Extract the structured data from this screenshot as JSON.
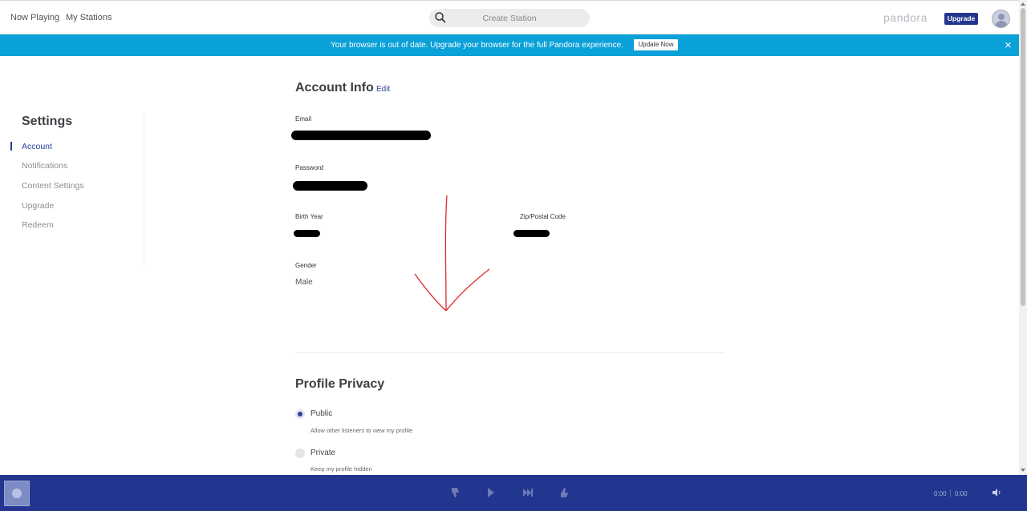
{
  "nav": {
    "now_playing": "Now Playing",
    "my_stations": "My Stations",
    "search_placeholder": "Create Station",
    "brand": "pandora",
    "upgrade": "Upgrade"
  },
  "banner": {
    "message": "Your browser is out of date. Upgrade your browser for the full Pandora experience.",
    "button": "Update Now",
    "close": "×"
  },
  "sidebar": {
    "title": "Settings",
    "items": [
      {
        "label": "Account",
        "active": true
      },
      {
        "label": "Notifications",
        "active": false
      },
      {
        "label": "Content Settings",
        "active": false
      },
      {
        "label": "Upgrade",
        "active": false
      },
      {
        "label": "Redeem",
        "active": false
      }
    ]
  },
  "account": {
    "title": "Account Info",
    "edit": "Edit",
    "email_label": "Email",
    "password_label": "Password",
    "birth_year_label": "Birth Year",
    "zip_label": "Zip/Postal Code",
    "gender_label": "Gender",
    "gender_value": "Male"
  },
  "privacy": {
    "title": "Profile Privacy",
    "options": [
      {
        "label": "Public",
        "desc": "Allow other listeners to view my profile",
        "selected": true
      },
      {
        "label": "Private",
        "desc": "Keep my profile hidden",
        "selected": false
      }
    ]
  },
  "player": {
    "elapsed": "0:00",
    "duration": "0:00"
  },
  "colors": {
    "brand_blue": "#22368f",
    "banner_blue": "#0aa0d8",
    "annotation_red": "#e0262b"
  }
}
